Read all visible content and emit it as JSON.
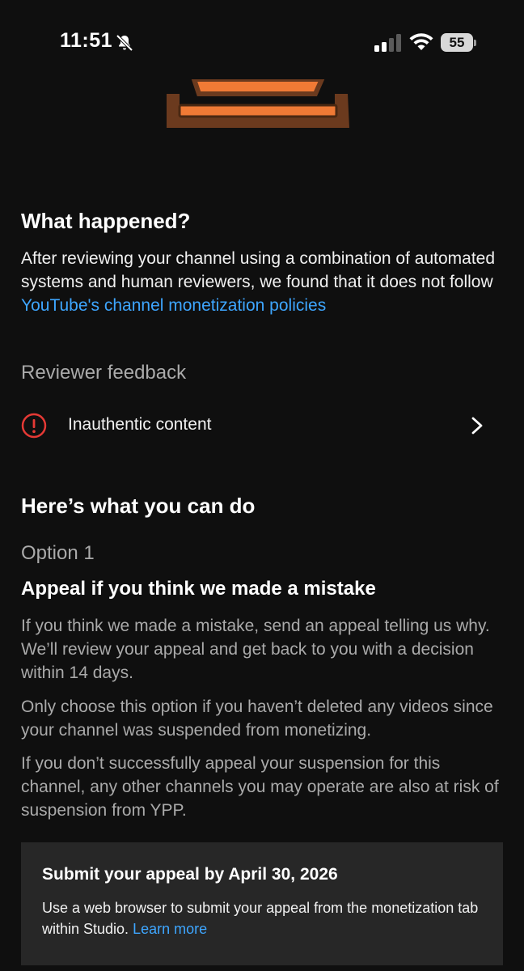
{
  "status_bar": {
    "time": "11:51",
    "battery": "55",
    "icons": [
      "bell-slash-icon",
      "signal-icon",
      "wifi-icon",
      "battery-icon"
    ]
  },
  "what_happened": {
    "title": "What happened?",
    "body": "After reviewing your channel using a combination of automated systems and human reviewers, we found that it does not follow ",
    "link": "YouTube's channel monetization policies"
  },
  "reviewer_feedback": {
    "title": "Reviewer feedback",
    "item_label": "Inauthentic content",
    "item_icon": "alert-circle-icon",
    "item_icon_color": "#e53935"
  },
  "what_you_can_do": {
    "title": "Here’s what you can do",
    "option_label": "Option 1",
    "option_title": "Appeal if you think we made a mistake",
    "paragraphs": [
      "If you think we made a mistake, send an appeal telling us why. We’ll review your appeal and get back to you with a decision within 14 days.",
      "Only choose this option if you haven’t deleted any videos since your channel was suspended from monetizing.",
      "If you don’t successfully appeal your suspension for this channel, any other channels you may operate are also at risk of suspension from YPP."
    ]
  },
  "appeal_card": {
    "title": "Submit your appeal by April 30, 2026",
    "body": "Use a web browser to submit your appeal from the monetization tab within Studio. ",
    "link": "Learn more"
  },
  "colors": {
    "background": "#0f0f0f",
    "link": "#3ea6ff",
    "card": "#272727",
    "illustration_orange": "#f07a35",
    "illustration_brown": "#6b3a1e"
  }
}
